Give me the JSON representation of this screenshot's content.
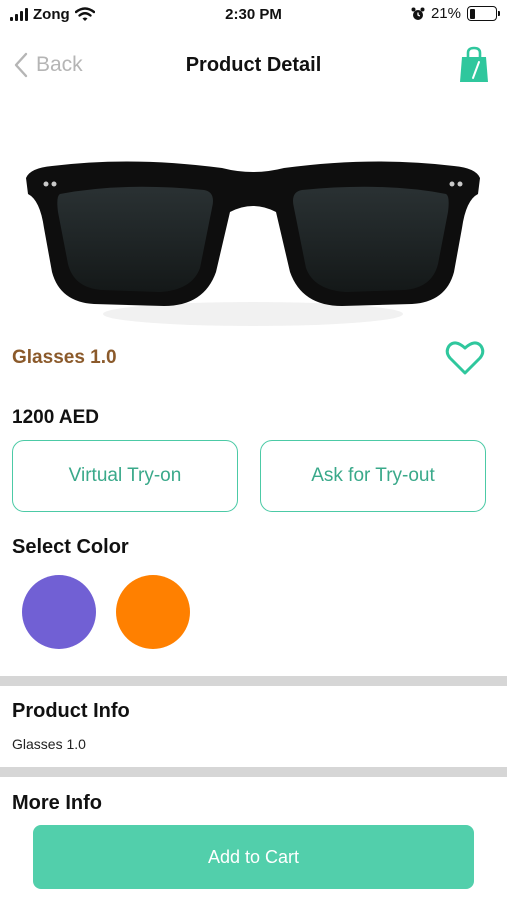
{
  "status_bar": {
    "carrier": "Zong",
    "time": "2:30 PM",
    "battery_percent": "21%",
    "battery_level": 0.21
  },
  "nav": {
    "back_label": "Back",
    "title": "Product Detail",
    "cart_icon": "shopping-bag-icon"
  },
  "product": {
    "name": "Glasses 1.0",
    "price": "1200 AED",
    "favorite_icon": "heart-outline-icon"
  },
  "actions": {
    "virtual_try_on": "Virtual Try-on",
    "ask_try_out": "Ask for Try-out"
  },
  "colors": {
    "label": "Select Color",
    "options": [
      "#7160d4",
      "#ff8000"
    ]
  },
  "sections": {
    "product_info_title": "Product Info",
    "product_info_text": "Glasses 1.0",
    "more_info_title": "More Info"
  },
  "cart": {
    "label": "Add to Cart"
  },
  "theme": {
    "accent": "#52cfab",
    "product_name_color": "#8b5a2b"
  }
}
